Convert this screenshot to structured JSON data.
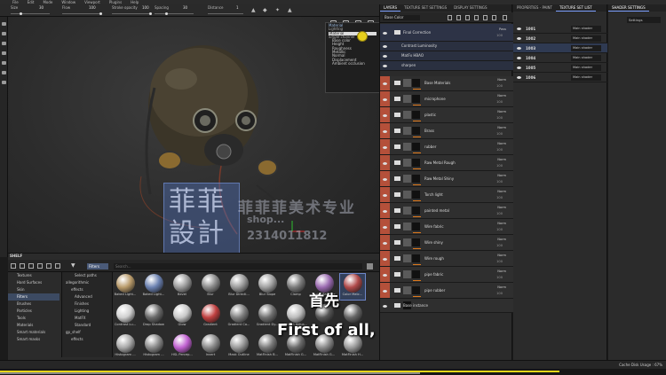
{
  "menu": [
    "File",
    "Edit",
    "Mode",
    "Window",
    "Viewport",
    "Plugins",
    "Help"
  ],
  "toolbar": {
    "size_label": "Size",
    "size_value": "30",
    "flow_label": "Flow",
    "flow_value": "100",
    "stroke_label": "Stroke opacity",
    "stroke_value": "100",
    "spacing_label": "Spacing",
    "spacing_value": "30",
    "distance_label": "Distance",
    "distance_value": "1"
  },
  "channel_dropdown": {
    "header": "Material",
    "selected": "Material",
    "group_lighting": "Lighting",
    "group_single": "Single channel",
    "items": [
      "Base color",
      "Height",
      "Roughness",
      "Metallic",
      "Normal",
      "Displacement",
      "Ambient occlusion"
    ]
  },
  "shelf": {
    "title": "SHELF",
    "filter_pill": "Filters",
    "search_placeholder": "Search...",
    "categories": [
      "Textures",
      "Hard Surfaces",
      "Skin",
      "Filters",
      "Brushes",
      "Particles",
      "Tools",
      "Materials",
      "Smart materials",
      "Smart masks"
    ],
    "active_category": "Filters",
    "tree": [
      "Select paths",
      "allegorithmic",
      "effects",
      "Advanced",
      "Finishes",
      "Lighting",
      "MatFX",
      "Standard",
      "gp_shelf",
      "effects"
    ],
    "tiles": [
      {
        "label": "Baked Light...",
        "color": "#b89a6a"
      },
      {
        "label": "Baked Light...",
        "color": "#6a80b0"
      },
      {
        "label": "Bevel",
        "color": "#9a9a9a"
      },
      {
        "label": "Blur",
        "color": "#8a8a8a"
      },
      {
        "label": "Blur Directi...",
        "color": "#9a9a9a"
      },
      {
        "label": "Blur Slope",
        "color": "#a0a0a0"
      },
      {
        "label": "Clamp",
        "color": "#7a7a7a"
      },
      {
        "label": "Color Balance",
        "color": "#9a6ab0"
      },
      {
        "label": "Color Matc...",
        "color": "#b04a4a"
      },
      {
        "label": "Contrast Lu...",
        "color": "#d0d0d0"
      },
      {
        "label": "Drop Shadow",
        "color": "#6a6a6a"
      },
      {
        "label": "Glow",
        "color": "#c8c8c8"
      },
      {
        "label": "Gradient",
        "color": "#c04040"
      },
      {
        "label": "Gradient Co...",
        "color": "#808080"
      },
      {
        "label": "Gradient Dy...",
        "color": "#707070"
      },
      {
        "label": "Height Adjus...",
        "color": "#bcbcbc"
      },
      {
        "label": "",
        "color": "#555555"
      },
      {
        "label": "",
        "color": "#666666"
      },
      {
        "label": "Histogram ...",
        "color": "#a8a8a8"
      },
      {
        "label": "Histogram ...",
        "color": "#8a8a8a"
      },
      {
        "label": "HSL Percep...",
        "color": "#c060d0"
      },
      {
        "label": "Invert",
        "color": "#8a8a8a"
      },
      {
        "label": "Mask Outline",
        "color": "#9a9a9a"
      },
      {
        "label": "MatFinish B...",
        "color": "#7a7a7a"
      },
      {
        "label": "MatFinish G...",
        "color": "#6a6a6a"
      },
      {
        "label": "MatFinish G...",
        "color": "#8a8a8a"
      },
      {
        "label": "MatFinish H...",
        "color": "#9a9a9a"
      }
    ]
  },
  "layers_panel": {
    "tabs": [
      "LAYERS",
      "TEXTURE SET SETTINGS",
      "DISPLAY SETTINGS"
    ],
    "channel_select": "Base Color",
    "layers": [
      {
        "name": "Final Correction",
        "blend": "Pass",
        "opacity": "100",
        "kind": "group-top"
      },
      {
        "name": "Contrast Luminosity",
        "blend": "",
        "opacity": "",
        "kind": "effect"
      },
      {
        "name": "MatFx HBAO",
        "blend": "",
        "opacity": "",
        "kind": "effect"
      },
      {
        "name": "sharpen",
        "blend": "",
        "opacity": "",
        "kind": "effect"
      },
      {
        "name": "Base Materials",
        "blend": "Norm",
        "opacity": "100",
        "kind": "folder"
      },
      {
        "name": "microphone",
        "blend": "Norm",
        "opacity": "100",
        "kind": "folder"
      },
      {
        "name": "plastic",
        "blend": "Norm",
        "opacity": "100",
        "kind": "folder"
      },
      {
        "name": "Brass",
        "blend": "Norm",
        "opacity": "100",
        "kind": "folder"
      },
      {
        "name": "rubber",
        "blend": "Norm",
        "opacity": "100",
        "kind": "folder"
      },
      {
        "name": "Raw Metal Rough",
        "blend": "Norm",
        "opacity": "100",
        "kind": "folder"
      },
      {
        "name": "Raw Metal Shiny",
        "blend": "Norm",
        "opacity": "100",
        "kind": "folder"
      },
      {
        "name": "Torch light",
        "blend": "Norm",
        "opacity": "100",
        "kind": "folder"
      },
      {
        "name": "painted metal",
        "blend": "Norm",
        "opacity": "100",
        "kind": "folder"
      },
      {
        "name": "Wire fabric",
        "blend": "Norm",
        "opacity": "100",
        "kind": "folder"
      },
      {
        "name": "Wire shiny",
        "blend": "Norm",
        "opacity": "100",
        "kind": "folder"
      },
      {
        "name": "Wire rough",
        "blend": "Norm",
        "opacity": "100",
        "kind": "folder"
      },
      {
        "name": "pipe fabric",
        "blend": "Norm",
        "opacity": "100",
        "kind": "folder"
      },
      {
        "name": "pipe rubber",
        "blend": "Norm",
        "opacity": "100",
        "kind": "folder"
      },
      {
        "name": "Base instance",
        "blend": "",
        "opacity": "",
        "kind": "base"
      }
    ]
  },
  "texture_set_panel": {
    "tabs": [
      "PROPERTIES - PAINT",
      "TEXTURE SET LIST"
    ],
    "sets": [
      {
        "name": "1001",
        "shader": "Main shader"
      },
      {
        "name": "1002",
        "shader": "Main shader"
      },
      {
        "name": "1003",
        "shader": "Main shader"
      },
      {
        "name": "1004",
        "shader": "Main shader"
      },
      {
        "name": "1005",
        "shader": "Main shader"
      },
      {
        "name": "1006",
        "shader": "Main shader"
      }
    ]
  },
  "shader_panel": {
    "tab": "SHADER SETTINGS",
    "settings_label": "Settings"
  },
  "status": {
    "cache": "Cache Disk Usage : 67%",
    "progress_fraction": 0.84
  },
  "subtitles": {
    "chinese": "首先",
    "english": "First of all,"
  },
  "watermark": {
    "line1": "菲菲菲美术专业",
    "line2": "shop...",
    "line3": "2314011812"
  }
}
